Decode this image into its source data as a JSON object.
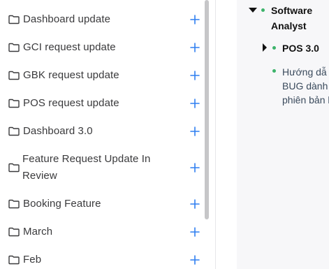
{
  "sidebar": {
    "folders": [
      {
        "label": "Dashboard update"
      },
      {
        "label": "GCI request update"
      },
      {
        "label": "GBK request update"
      },
      {
        "label": "POS request update"
      },
      {
        "label": "Dashboard 3.0"
      },
      {
        "label": "Feature Request Update In Review"
      },
      {
        "label": "Booking Feature"
      },
      {
        "label": "March"
      },
      {
        "label": "Feb"
      }
    ],
    "add_icon": "plus-icon",
    "folder_icon": "folder-icon"
  },
  "tree": {
    "root": {
      "label": "Software Analyst"
    },
    "child": {
      "label": "POS 3.0"
    },
    "description": {
      "line1": "Hướng dẫ",
      "line2": "BUG dành",
      "line3": "phiên bản l"
    }
  },
  "colors": {
    "accent": "#2f7ff0",
    "bullet": "#3db36b",
    "panel_bg": "#f7f7f9"
  }
}
